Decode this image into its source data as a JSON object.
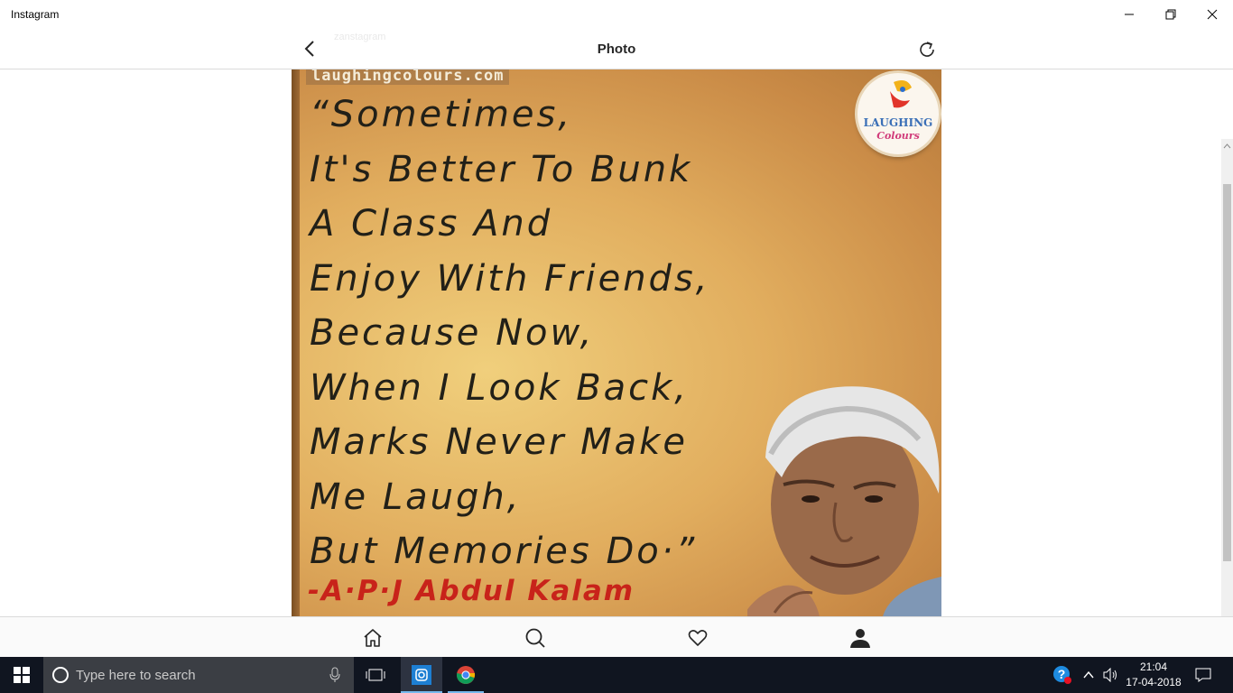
{
  "window": {
    "title": "Instagram"
  },
  "header": {
    "title": "Photo",
    "ghost_text": "zanstagram"
  },
  "photo": {
    "watermark": "laughingcolours.com",
    "logo_text_top": "LAUGHING",
    "logo_text_bottom": "Colours",
    "quote_lines": [
      "“Sometimes,",
      "It's Better To Bunk",
      "A Class And",
      "Enjoy With Friends,",
      "Because Now,",
      "When I Look Back,",
      "Marks Never Make",
      "Me Laugh,",
      "But Memories Do·”"
    ],
    "author": "-A·P·J Abdul Kalam"
  },
  "bottom_nav": [
    "home-icon",
    "search-icon",
    "heart-icon",
    "profile-icon"
  ],
  "taskbar": {
    "search_placeholder": "Type here to search",
    "time": "21:04",
    "date": "17-04-2018"
  },
  "colors": {
    "accent": "#76b9ed",
    "taskbar": "#101520",
    "author_red": "#c8231a"
  }
}
